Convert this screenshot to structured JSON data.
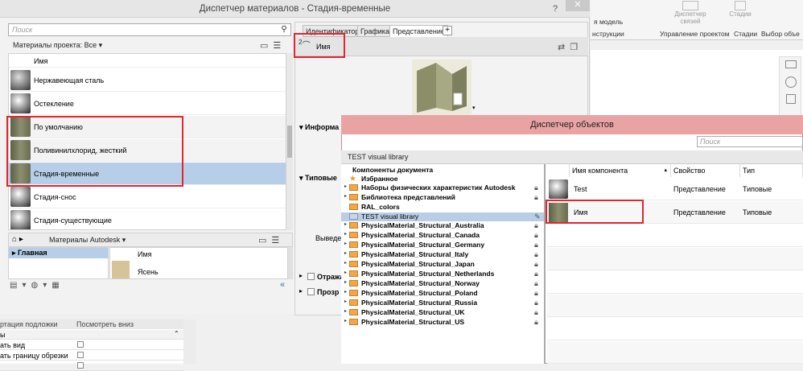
{
  "material_manager": {
    "title": "Диспетчер материалов - Стадия-временные",
    "help": "?",
    "close": "✕",
    "search_placeholder": "Поиск",
    "filter_label": "Материалы проекта: Все",
    "column_header": "Имя",
    "materials": [
      {
        "name": "Нержавеющая сталь",
        "thumb": "sphere-gray"
      },
      {
        "name": "Остекление",
        "thumb": "sphere-dark"
      },
      {
        "name": "По умолчанию",
        "thumb": "wall-green"
      },
      {
        "name": "Поливинилхлорид, жесткий",
        "thumb": "wall-green"
      },
      {
        "name": "Стадия-временные",
        "thumb": "wall-green",
        "selected": true
      },
      {
        "name": "Стадия-снос",
        "thumb": "sphere-dark"
      },
      {
        "name": "Стадия-существующие",
        "thumb": "sphere-dark"
      }
    ],
    "library_bar": "Материалы Autodesk",
    "library_tree": [
      "Главная"
    ],
    "library_column": "Имя",
    "library_item": "Ясень",
    "tabs": [
      "Идентификатор",
      "Графика",
      "Представление"
    ],
    "active_tab": "Представление",
    "asset_users": "2",
    "asset_name": "Имя",
    "sections": [
      "Информа",
      "Типовые",
      "Отража",
      "Прозр"
    ],
    "field_label": "Выведе"
  },
  "ribbon": {
    "items": [
      {
        "label": "я модель",
        "value": ""
      },
      {
        "label": "нструкции",
        "value": ""
      },
      {
        "label": "Управление проектом",
        "button": "Диспетчер связей"
      },
      {
        "label": "Стадии",
        "button": "Стадии"
      },
      {
        "label": "Выбор объе",
        "button": ""
      }
    ]
  },
  "properties": {
    "col_a": "ртация подложки",
    "col_b": "Посмотреть вниз",
    "rows": [
      "ы",
      "ать вид",
      "ать границу обрезки",
      ""
    ]
  },
  "object_manager": {
    "title": "Диспетчер объектов",
    "search_placeholder": "Поиск",
    "library": "TEST visual library",
    "tree_header": "Компоненты документа",
    "tree": [
      {
        "label": "Избранное",
        "type": "star"
      },
      {
        "label": "Наборы физических характеристик Autodesk",
        "locked": true
      },
      {
        "label": "Библиотека представлений",
        "locked": true
      },
      {
        "label": "RAL_colors",
        "locked": false
      },
      {
        "label": "TEST visual library",
        "locked": false,
        "selected": true
      },
      {
        "label": "PhysicalMaterial_Structural_Australia",
        "locked": true
      },
      {
        "label": "PhysicalMaterial_Structural_Canada",
        "locked": true
      },
      {
        "label": "PhysicalMaterial_Structural_Germany",
        "locked": true
      },
      {
        "label": "PhysicalMaterial_Structural_Italy",
        "locked": true
      },
      {
        "label": "PhysicalMaterial_Structural_Japan",
        "locked": true
      },
      {
        "label": "PhysicalMaterial_Structural_Netherlands",
        "locked": true
      },
      {
        "label": "PhysicalMaterial_Structural_Norway",
        "locked": true
      },
      {
        "label": "PhysicalMaterial_Structural_Poland",
        "locked": true
      },
      {
        "label": "PhysicalMaterial_Structural_Russia",
        "locked": true
      },
      {
        "label": "PhysicalMaterial_Structural_UK",
        "locked": true
      },
      {
        "label": "PhysicalMaterial_Structural_US",
        "locked": true
      }
    ],
    "columns": [
      "Имя компонента",
      "Свойство",
      "Тип"
    ],
    "rows": [
      {
        "name": "Test",
        "property": "Представление",
        "type": "Типовые",
        "thumb": "sphere-dark"
      },
      {
        "name": "Имя",
        "property": "Представление",
        "type": "Типовые",
        "thumb": "wall-green"
      }
    ]
  },
  "colors": {
    "accent": "#b6cee8",
    "highlight": "#e0262e",
    "om_title": "#e9a3a3"
  }
}
